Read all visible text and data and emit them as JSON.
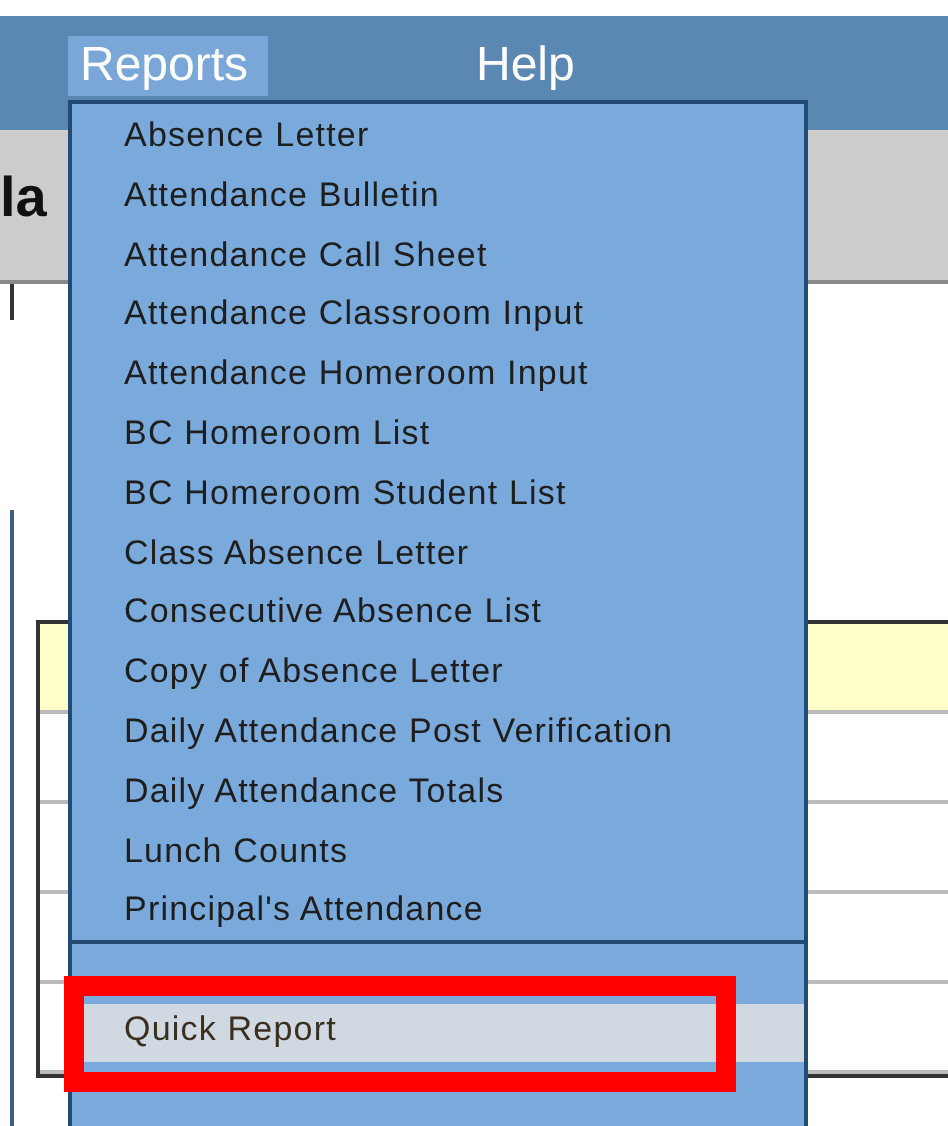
{
  "menubar": [
    {
      "label": "Reports",
      "selected": true
    },
    {
      "label": "Help",
      "selected": false
    }
  ],
  "page_title": "la",
  "menu": {
    "groups": [
      {
        "items": [
          {
            "label": "Absence Letter",
            "selected": false
          },
          {
            "label": "Attendance Bulletin",
            "selected": false
          },
          {
            "label": "Attendance Call Sheet",
            "selected": false
          },
          {
            "label": "Attendance Classroom Input",
            "selected": false
          },
          {
            "label": "Attendance Homeroom Input",
            "selected": false
          },
          {
            "label": "BC Homeroom List",
            "selected": false
          },
          {
            "label": "BC Homeroom Student List",
            "selected": false
          },
          {
            "label": "Class Absence Letter",
            "selected": false
          },
          {
            "label": "Consecutive Absence List",
            "selected": false
          },
          {
            "label": "Copy of Absence Letter",
            "selected": false
          },
          {
            "label": "Daily Attendance Post Verification",
            "selected": false
          },
          {
            "label": "Daily Attendance Totals",
            "selected": false
          },
          {
            "label": "Lunch Counts",
            "selected": false
          },
          {
            "label": "Principal's Attendance",
            "selected": false
          }
        ]
      },
      {
        "items": [
          {
            "label": "Quick Report",
            "selected": true
          }
        ]
      }
    ]
  }
}
